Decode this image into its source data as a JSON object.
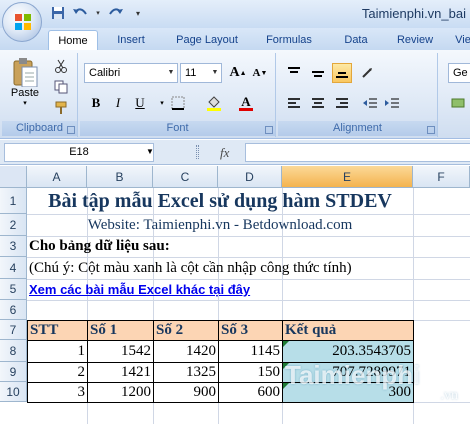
{
  "window": {
    "title": "Taimienphi.vn_bai"
  },
  "tabs": [
    "Home",
    "Insert",
    "Page Layout",
    "Formulas",
    "Data",
    "Review",
    "Vie"
  ],
  "ribbon": {
    "clipboard": {
      "label": "Clipboard",
      "paste": "Paste"
    },
    "font": {
      "label": "Font",
      "family": "Calibri",
      "size": "11",
      "bold": "B",
      "italic": "I",
      "underline": "U",
      "grow": "A",
      "shrink": "A",
      "color": "A"
    },
    "alignment": {
      "label": "Alignment",
      "overflow": "Ge"
    }
  },
  "formula_bar": {
    "name_box": "E18",
    "fx": "fx",
    "formula": ""
  },
  "columns": [
    "A",
    "B",
    "C",
    "D",
    "E",
    "F"
  ],
  "rows": [
    "1",
    "2",
    "3",
    "4",
    "5",
    "6",
    "7",
    "8",
    "9",
    "10"
  ],
  "sheet": {
    "title": "Bài tập mẫu Excel sử dụng hàm STDEV",
    "website": "Website: Taimienphi.vn - Betdownload.com",
    "row3": "Cho bảng dữ liệu sau:",
    "row4": "(Chú ý: Cột màu xanh là cột cần nhập công thức tính)",
    "link": "Xem các bài mẫu Excel khác tại đây",
    "table": {
      "headers": [
        "STT",
        "Số 1",
        "Số 2",
        "Số 3",
        "Kết quả"
      ],
      "rows": [
        [
          "1",
          "1542",
          "1420",
          "1145",
          "203.3543705"
        ],
        [
          "2",
          "1421",
          "1325",
          "150",
          "707.7289971"
        ],
        [
          "3",
          "1200",
          "900",
          "600",
          "300"
        ]
      ]
    }
  },
  "watermark": {
    "text": "Taimienphi",
    "suffix": ".vn"
  },
  "colors": {
    "header_fill": "#fcd5b4",
    "result_fill": "#b7dee8",
    "title_color": "#17375e",
    "ribbon_blue": "#dfe9f6"
  }
}
